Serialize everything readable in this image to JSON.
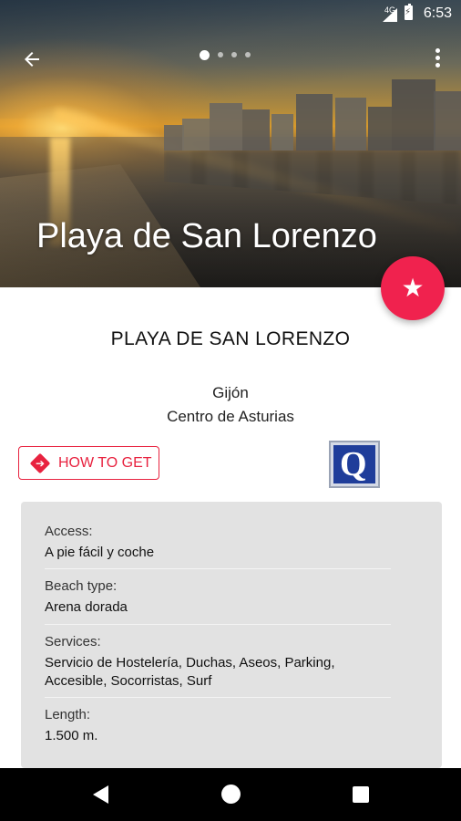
{
  "status_bar": {
    "time": "6:53",
    "network": "4G"
  },
  "hero": {
    "title": "Playa de San Lorenzo",
    "carousel": {
      "total": 4,
      "active_index": 0
    }
  },
  "beach": {
    "name_heading": "PLAYA DE SAN LORENZO",
    "town": "Gijón",
    "region": "Centro de Asturias"
  },
  "actions": {
    "how_to_get_label": "HOW TO GET",
    "favorite_icon": "star-icon",
    "quality_badge_icon": "q-quality-icon"
  },
  "details": [
    {
      "label": "Access:",
      "value": "A pie fácil y coche"
    },
    {
      "label": "Beach type:",
      "value": "Arena dorada"
    },
    {
      "label": "Services:",
      "value": "Servicio de Hostelería, Duchas, Aseos, Parking, Accesible, Socorristas, Surf"
    },
    {
      "label": "Length:",
      "value": "1.500 m."
    }
  ],
  "colors": {
    "accent": "#f0224e",
    "button_outline": "#e8223f",
    "card_background": "#e2e2e2",
    "badge_blue": "#1f3d9a"
  }
}
